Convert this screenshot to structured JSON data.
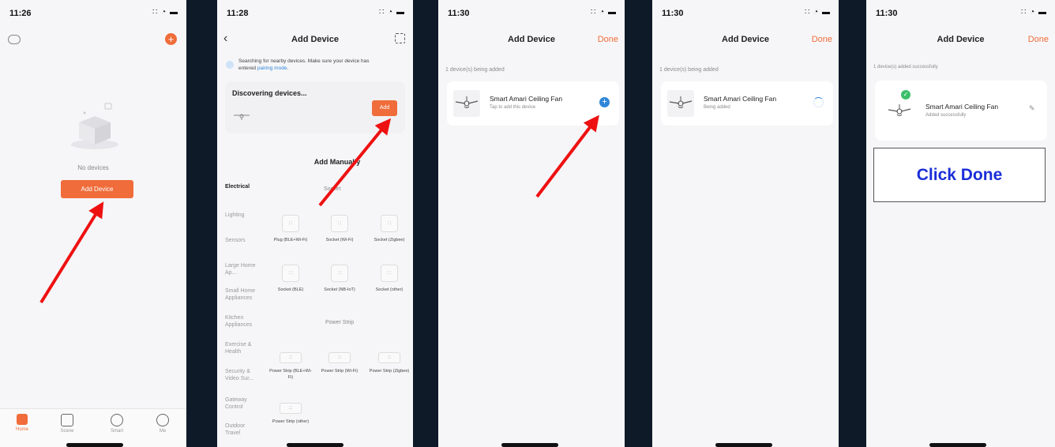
{
  "screen1": {
    "time": "11:26",
    "status_icons": "∷ ◔ ▬",
    "empty_text": "No devices",
    "add_device_label": "Add Device",
    "tabs": [
      {
        "label": "Home"
      },
      {
        "label": "Scene"
      },
      {
        "label": "Smart"
      },
      {
        "label": "Me"
      }
    ],
    "accent": "#f06c3a"
  },
  "screen2": {
    "time": "11:28",
    "status_icons": "∷ ◔ ▬",
    "title": "Add Device",
    "search_text_1": "Searching for nearby devices. Make sure your device has",
    "search_text_2a": "entered ",
    "search_text_2b": "pairing mode",
    "search_text_2c": ".",
    "discovering": "Discovering devices...",
    "add_label": "Add",
    "add_manually": "Add Manually",
    "categories": [
      "Electrical",
      "Lighting",
      "Sensors",
      "Large Home Ap...",
      "Small Home Appliances",
      "Kitchen Appliances",
      "Exercise & Health",
      "Security & Video Sur...",
      "Gateway Control",
      "Outdoor Travel"
    ],
    "section_socket": "Socket",
    "section_strip": "Power Strip",
    "sockets": [
      "Plug (BLE+Wi-Fi)",
      "Socket (Wi-Fi)",
      "Socket (Zigbee)",
      "Socket (BLE)",
      "Socket (NB-IoT)",
      "Socket (other)"
    ],
    "strips": [
      "Power Strip (BLE+Wi-Fi)",
      "Power Strip (Wi-Fi)",
      "Power Strip (Zigbee)",
      "Power Strip (other)"
    ]
  },
  "screen3": {
    "time": "11:30",
    "status_icons": "∷ ◔ ▬",
    "title": "Add Device",
    "done": "Done",
    "status": "1 device(s) being added",
    "device_name": "Smart Amari Ceiling Fan",
    "device_sub": "Tap to add this device"
  },
  "screen4": {
    "time": "11:30",
    "status_icons": "∷ ◔ ▬",
    "title": "Add Device",
    "done": "Done",
    "status": "1 device(s) being added",
    "device_name": "Smart Amari Ceiling Fan",
    "device_sub": "Being added"
  },
  "screen5": {
    "time": "11:30",
    "status_icons": "∷ ◔ ▬",
    "title": "Add Device",
    "done": "Done",
    "status": "1 device(s) added successfully",
    "device_name": "Smart Amari Ceiling Fan",
    "device_sub": "Added successfully",
    "callout": "Click Done",
    "callout_color": "#1a2ed8"
  },
  "arrow_color": "#ee1111",
  "background": "#0f1a29"
}
